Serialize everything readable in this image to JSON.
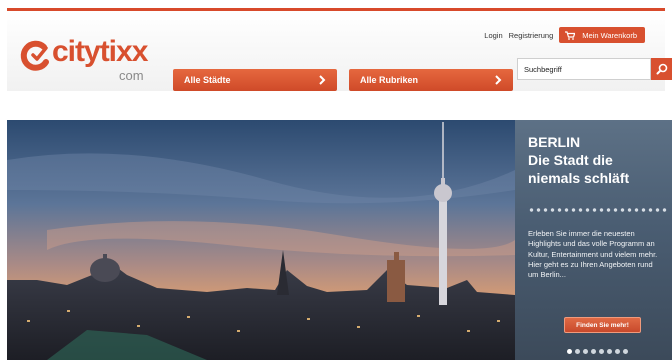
{
  "header": {
    "logo": {
      "word": "citytixx",
      "suffix": "com"
    },
    "top_links": {
      "login": "Login",
      "register": "Registrierung"
    },
    "cart": {
      "label": "Mein Warenkorb",
      "icon": "cart-icon"
    }
  },
  "nav": {
    "cities": {
      "label": "Alle Städte",
      "icon": "chevron-right-icon"
    },
    "categories": {
      "label": "Alle Rubriken",
      "icon": "chevron-right-icon"
    }
  },
  "search": {
    "value": "Suchbegriff",
    "icon": "search-icon"
  },
  "hero": {
    "title_line1": "BERLIN",
    "title_line2": "Die Stadt die",
    "title_line3": "niemals schläft",
    "description": "Erleben Sie immer die neuesten Highlights und das volle Programm an Kultur, Entertainment und vielem mehr. Hier geht es zu Ihren Angeboten rund um Berlin...",
    "cta_label": "Finden Sie mehr!",
    "slide_count": 8,
    "active_slide": 1
  },
  "colors": {
    "brand": "#d8502f",
    "panel": "#4a5d72"
  }
}
